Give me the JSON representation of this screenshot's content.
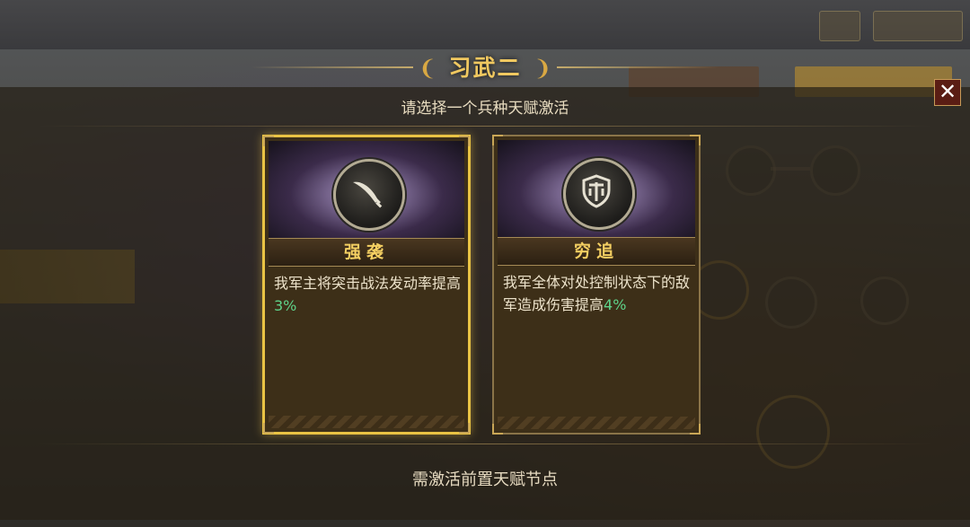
{
  "dialog": {
    "title": "习武二",
    "subtitle": "请选择一个兵种天赋激活",
    "close_glyph": "✕",
    "notice": "需激活前置天赋节点"
  },
  "cards": [
    {
      "name": "强袭",
      "desc_main": "我军主将突击战法发动率提高",
      "desc_value": "3%",
      "icon": "sword-icon",
      "selected": true
    },
    {
      "name": "穷追",
      "desc_main": "我军全体对处控制状态下的敌军造成伤害提高",
      "desc_value": "4%",
      "icon": "shield-icon",
      "selected": false
    }
  ],
  "colors": {
    "title_gold": "#f0c860",
    "selected_border": "#e9c344",
    "percent_green": "#5fd38a",
    "close_bg": "#5a1d14"
  }
}
